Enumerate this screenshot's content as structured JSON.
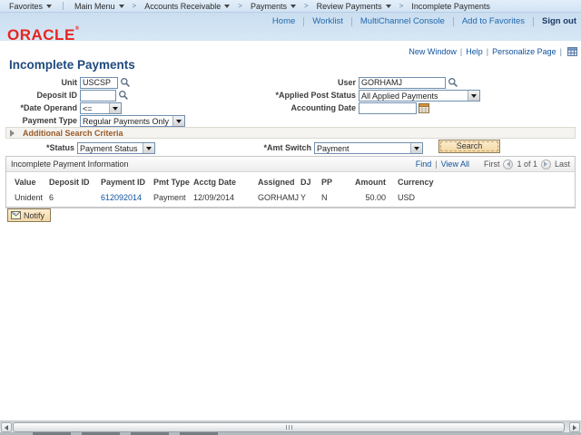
{
  "colors": {
    "header_blue": "#cadef0",
    "breadcrumb_blue": "#d2e3f3",
    "oracle_red": "#e8251f",
    "link_blue": "#1053a0",
    "title_navy": "#1f4a7d",
    "section_brown": "#9a5a28",
    "button_tan": "#f3d8a6",
    "field_border": "#6f8faf"
  },
  "icons": {
    "lookup": "magnifier-icon",
    "dropdown": "triangle-down-icon",
    "calendar": "calendar-icon",
    "notify": "envelope-icon",
    "collapse": "triangle-right-icon",
    "prev": "circle-arrow-left-icon",
    "next": "circle-arrow-right-icon",
    "personalize": "grid-window-icon"
  },
  "breadcrumb": {
    "chevron": ">",
    "items": [
      "Favorites",
      "Main Menu",
      "Accounts Receivable",
      "Payments",
      "Review Payments",
      "Incomplete Payments"
    ]
  },
  "header": {
    "logo": "ORACLE",
    "reg_mark": "®",
    "links": [
      "Home",
      "Worklist",
      "MultiChannel Console",
      "Add to Favorites"
    ],
    "signout": "Sign out"
  },
  "pagebar": {
    "links": [
      "New Window",
      "Help",
      "Personalize Page"
    ],
    "separator": "|"
  },
  "page": {
    "title": "Incomplete Payments"
  },
  "form": {
    "unit": {
      "label": "Unit",
      "value": "USCSP"
    },
    "deposit_id": {
      "label": "Deposit ID",
      "value": ""
    },
    "date_operand": {
      "label": "*Date Operand",
      "value": "<="
    },
    "payment_type": {
      "label": "Payment Type",
      "value": "Regular Payments Only"
    },
    "user": {
      "label": "User",
      "value": "GORHAMJ"
    },
    "applied_post_status": {
      "label": "*Applied Post Status",
      "value": "All Applied Payments"
    },
    "accounting_date": {
      "label": "Accounting Date",
      "value": ""
    }
  },
  "sections": {
    "additional_search": "Additional Search Criteria"
  },
  "search_row": {
    "status": {
      "label": "*Status",
      "value": "Payment Status"
    },
    "amt_switch": {
      "label": "*Amt Switch",
      "value": "Payment"
    },
    "search_button": "Search"
  },
  "grid": {
    "title": "Incomplete Payment Information",
    "find": "Find",
    "view_all": "View All",
    "first": "First",
    "page_indicator": "1 of 1",
    "last": "Last",
    "separator": "|",
    "headers": [
      "Value",
      "Deposit ID",
      "Payment ID",
      "Pmt Type",
      "Acctg Date",
      "Assigned",
      "DJ",
      "PP",
      "Amount",
      "Currency"
    ],
    "row": {
      "value": "Unident",
      "deposit_id": "6",
      "payment_id": "612092014",
      "pmt_type": "Payment",
      "acctg_date": "12/09/2014",
      "assigned": "GORHAMJ",
      "dj": "Y",
      "pp": "N",
      "amount": "50.00",
      "currency": "USD"
    }
  },
  "footer": {
    "notify_button": "Notify"
  }
}
